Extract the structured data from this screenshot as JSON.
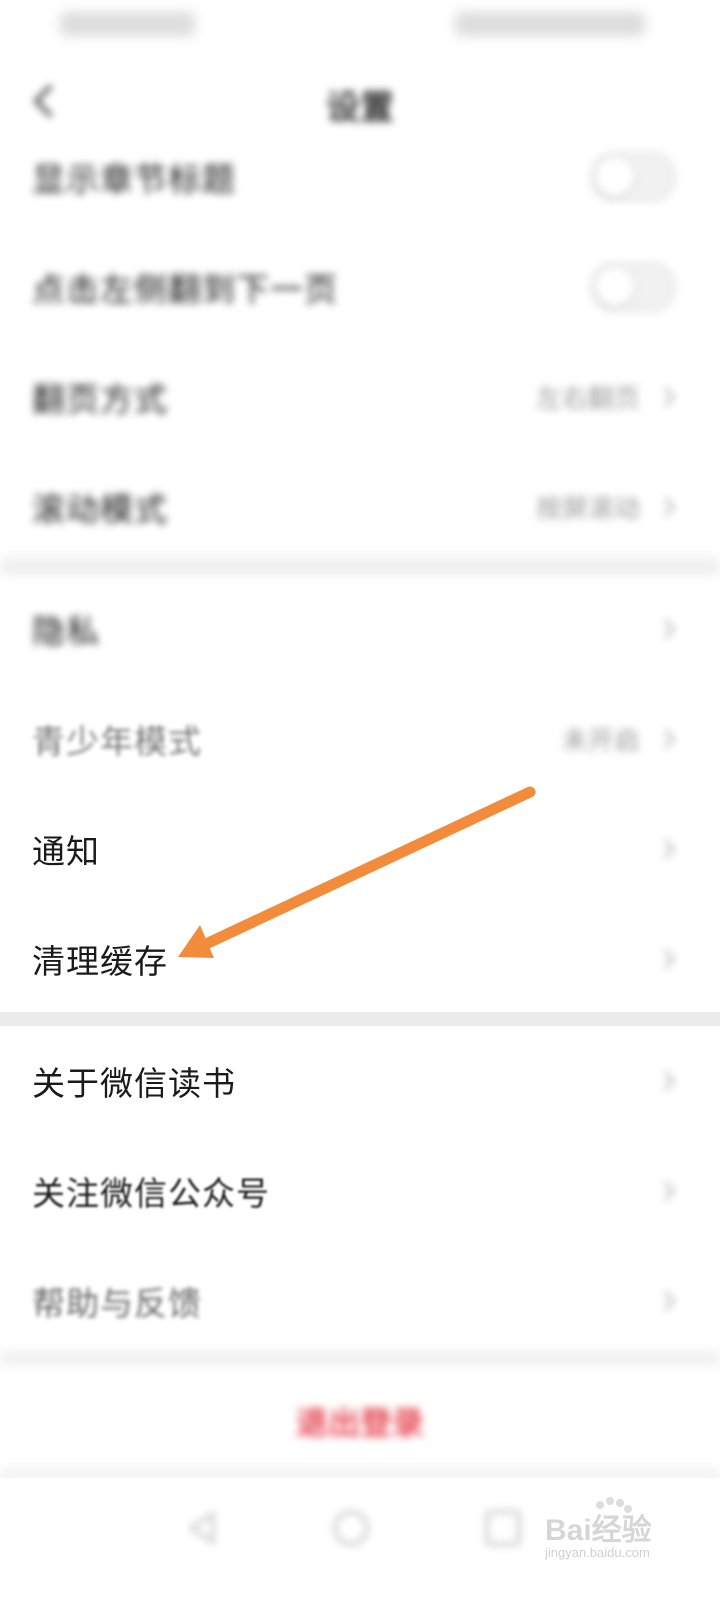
{
  "nav": {
    "title": "设置"
  },
  "rows_top": [
    {
      "label": "显示章节标题",
      "control": "toggle"
    },
    {
      "label": "点击左侧翻到下一页",
      "control": "toggle"
    },
    {
      "label": "翻页方式",
      "value": "左右翻页"
    },
    {
      "label": "滚动模式",
      "value": "按屏滚动"
    }
  ],
  "rows_mid": [
    {
      "label": "隐私"
    },
    {
      "label": "青少年模式",
      "value": "未开启"
    },
    {
      "label": "通知"
    },
    {
      "label": "清理缓存"
    }
  ],
  "rows_bottom": [
    {
      "label": "关于微信读书"
    },
    {
      "label": "关注微信公众号"
    },
    {
      "label": "帮助与反馈"
    }
  ],
  "logout": {
    "label": "退出登录"
  },
  "watermark": {
    "brand": "Bai经验",
    "url": "jingyan.baidu.com"
  },
  "colors": {
    "arrow": "#F28C3C",
    "logout": "#E64551",
    "divider": "#EDEDED"
  }
}
